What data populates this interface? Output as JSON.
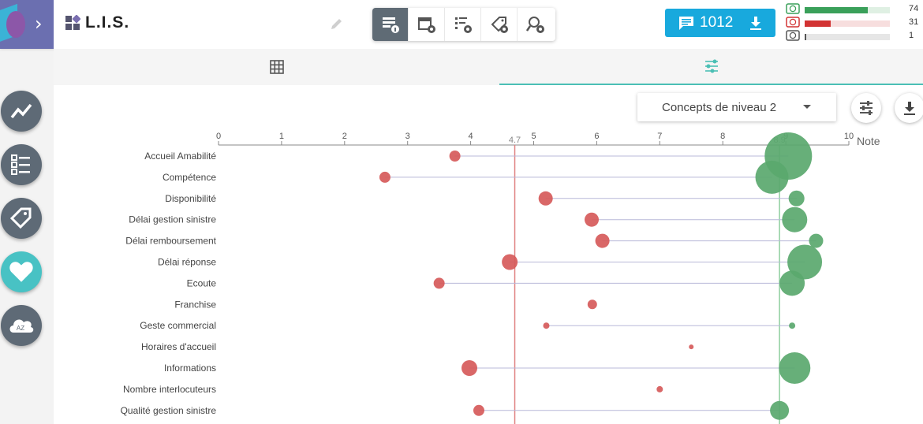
{
  "header": {
    "app_title": "L.I.S.",
    "icons": [
      "logo-icon",
      "app-grid-icon",
      "edit-icon"
    ],
    "view_buttons": [
      "list-info-icon",
      "calendar-gear-icon",
      "checklist-gear-icon",
      "tag-gear-icon",
      "user-search-gear-icon"
    ],
    "comments_count": "1012",
    "stats": [
      {
        "face": "smile-face-icon",
        "color": "#3aa05a",
        "track": "#dff0e3",
        "fraction": 0.74,
        "value": "74"
      },
      {
        "face": "sad-face-icon",
        "color": "#d23333",
        "track": "#f7dede",
        "fraction": 0.31,
        "value": "31"
      },
      {
        "face": "neutral-face-icon",
        "color": "#555555",
        "track": "#e6e6e6",
        "fraction": 0.015,
        "value": "1"
      }
    ]
  },
  "tabs": [
    "table-view-icon",
    "chart-view-icon"
  ],
  "sidenav": [
    "line-chart-icon",
    "checklist-icon",
    "tags-icon",
    "heart-icon",
    "az-cloud-icon"
  ],
  "sidenav_az": "AZ",
  "controls": {
    "level_select": "Concepts de niveau 2"
  },
  "chart_data": {
    "type": "scatter",
    "xlabel": "Note",
    "xlim": [
      0,
      10
    ],
    "ticks": [
      "0",
      "1",
      "2",
      "3",
      "4",
      "5",
      "6",
      "7",
      "8",
      "9",
      "10"
    ],
    "ref_lines": [
      {
        "value": 4.7,
        "label": "4.7",
        "color": "#e08080"
      },
      {
        "value": 8.9,
        "label": "8.9",
        "color": "#8fcf9f"
      }
    ],
    "categories": [
      "Accueil Amabilité",
      "Compétence",
      "Disponibilité",
      "Délai gestion sinistre",
      "Délai remboursement",
      "Délai réponse",
      "Ecoute",
      "Franchise",
      "Geste commercial",
      "Horaires d'accueil",
      "Informations",
      "Nombre interlocuteurs",
      "Qualité gestion sinistre"
    ],
    "series": [
      {
        "color": "#d65a5a",
        "values": [
          3.75,
          2.64,
          5.19,
          5.92,
          6.09,
          4.62,
          3.5,
          5.93,
          5.2,
          7.5,
          3.98,
          7.0,
          4.13
        ],
        "sizes": [
          7,
          7,
          9,
          9,
          9,
          10,
          7,
          6,
          4,
          3,
          10,
          4,
          7
        ]
      },
      {
        "color": "#5aa86e",
        "values": [
          9.04,
          8.78,
          9.17,
          9.14,
          9.48,
          9.3,
          9.1,
          null,
          9.1,
          null,
          9.14,
          null,
          8.9
        ],
        "sizes": [
          30,
          21,
          10,
          16,
          9,
          22,
          16,
          0,
          4,
          0,
          20,
          0,
          12
        ]
      }
    ]
  }
}
